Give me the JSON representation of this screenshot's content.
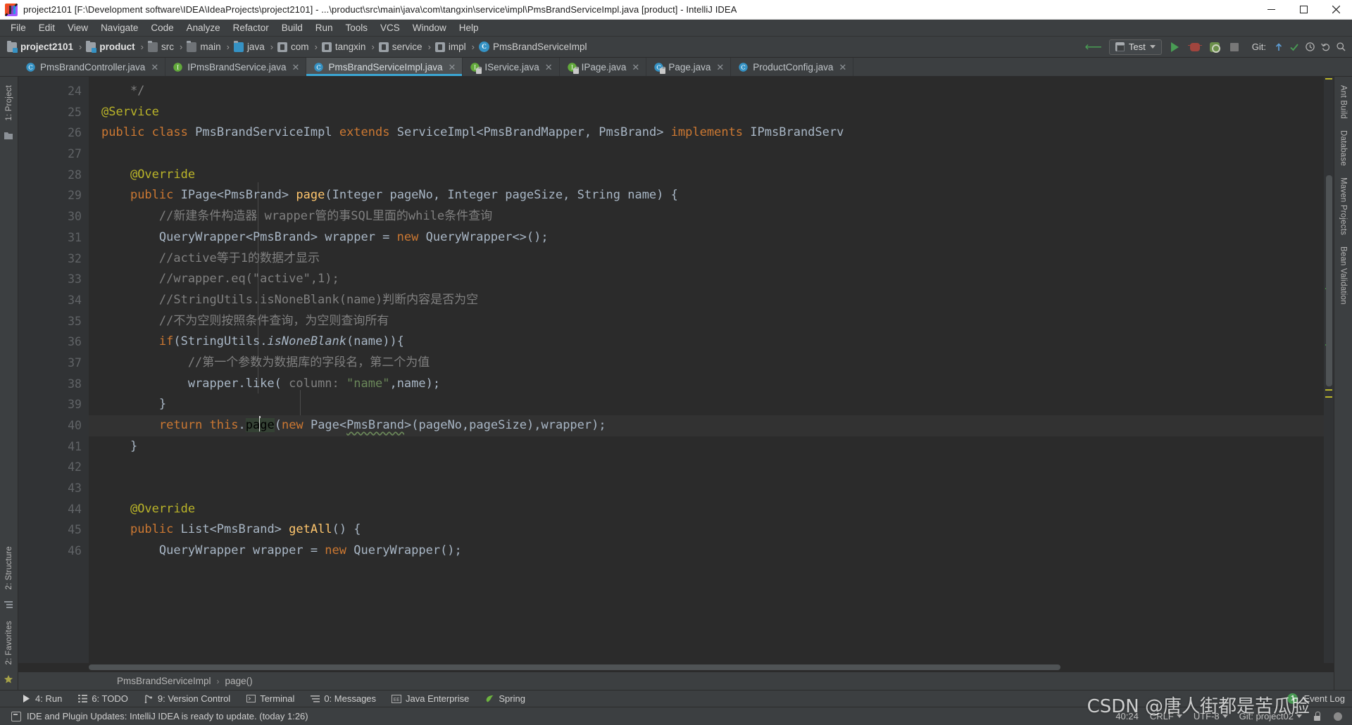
{
  "window": {
    "title": "project2101 [F:\\Development software\\IDEA\\IdeaProjects\\project2101] - ...\\product\\src\\main\\java\\com\\tangxin\\service\\impl\\PmsBrandServiceImpl.java [product] - IntelliJ IDEA",
    "minimize": "minimize-icon",
    "maximize": "maximize-icon",
    "close": "close-icon"
  },
  "menubar": [
    {
      "label": "File"
    },
    {
      "label": "Edit"
    },
    {
      "label": "View"
    },
    {
      "label": "Navigate"
    },
    {
      "label": "Code"
    },
    {
      "label": "Analyze"
    },
    {
      "label": "Refactor"
    },
    {
      "label": "Build"
    },
    {
      "label": "Run"
    },
    {
      "label": "Tools"
    },
    {
      "label": "VCS"
    },
    {
      "label": "Window"
    },
    {
      "label": "Help"
    }
  ],
  "navbar": {
    "crumbs": [
      {
        "label": "project2101",
        "icon": "module-folder-icon",
        "bold": true
      },
      {
        "label": "product",
        "icon": "module-folder-icon",
        "bold": true
      },
      {
        "label": "src",
        "icon": "folder-icon",
        "bold": false
      },
      {
        "label": "main",
        "icon": "folder-icon",
        "bold": false
      },
      {
        "label": "java",
        "icon": "source-root-folder-icon",
        "bold": false
      },
      {
        "label": "com",
        "icon": "package-icon",
        "bold": false
      },
      {
        "label": "tangxin",
        "icon": "package-icon",
        "bold": false
      },
      {
        "label": "service",
        "icon": "package-icon",
        "bold": false
      },
      {
        "label": "impl",
        "icon": "package-icon",
        "bold": false
      },
      {
        "label": "PmsBrandServiceImpl",
        "icon": "class-icon",
        "bold": false
      }
    ],
    "separator": "›",
    "run_config": "Test",
    "git_label": "Git:",
    "run_tooltip": "run-button",
    "debug_tooltip": "debug-button"
  },
  "editor_tabs": [
    {
      "label": "PmsBrandController.java",
      "icon": "java-class-icon",
      "kind": "class",
      "active": false,
      "locked": false
    },
    {
      "label": "IPmsBrandService.java",
      "icon": "java-interface-icon",
      "kind": "interface",
      "active": false,
      "locked": false
    },
    {
      "label": "PmsBrandServiceImpl.java",
      "icon": "java-class-icon",
      "kind": "class",
      "active": true,
      "locked": false
    },
    {
      "label": "IService.java",
      "icon": "java-interface-icon",
      "kind": "interface",
      "active": false,
      "locked": true
    },
    {
      "label": "IPage.java",
      "icon": "java-interface-icon",
      "kind": "interface",
      "active": false,
      "locked": true
    },
    {
      "label": "Page.java",
      "icon": "java-class-icon",
      "kind": "class",
      "active": false,
      "locked": true
    },
    {
      "label": "ProductConfig.java",
      "icon": "java-class-icon",
      "kind": "class",
      "active": false,
      "locked": false
    }
  ],
  "left_rail": [
    {
      "label": "1: Project"
    }
  ],
  "left_rail_bottom": [
    {
      "label": "2: Structure"
    },
    {
      "label": "2: Favorites"
    }
  ],
  "right_rail": [
    {
      "label": "Ant Build"
    },
    {
      "label": "Database"
    },
    {
      "label": "Maven Projects"
    },
    {
      "label": "Bean Validation"
    }
  ],
  "code": {
    "first_line_number": 24,
    "lines": [
      {
        "n": 24,
        "text": "    */",
        "fold": "minus",
        "mark": ""
      },
      {
        "n": 25,
        "text": "@Service",
        "mark": ""
      },
      {
        "n": 26,
        "text": "public class PmsBrandServiceImpl extends ServiceImpl<PmsBrandMapper, PmsBrand> implements IPmsBrandServ",
        "mark": "spring-bean-gutter-icon"
      },
      {
        "n": 27,
        "text": "",
        "mark": ""
      },
      {
        "n": 28,
        "text": "    @Override",
        "mark": ""
      },
      {
        "n": 29,
        "text": "    public IPage<PmsBrand> page(Integer pageNo, Integer pageSize, String name) {",
        "mark": "implementing-method-icon"
      },
      {
        "n": 30,
        "text": "        //新建条件构造器 wrapper管的事SQL里面的while条件查询",
        "mark": ""
      },
      {
        "n": 31,
        "text": "        QueryWrapper<PmsBrand> wrapper = new QueryWrapper<>();",
        "mark": ""
      },
      {
        "n": 32,
        "text": "        //active等于1的数据才显示",
        "mark": ""
      },
      {
        "n": 33,
        "text": "        //wrapper.eq(\"active\",1);",
        "mark": ""
      },
      {
        "n": 34,
        "text": "        //StringUtils.isNoneBlank(name)判断内容是否为空",
        "mark": ""
      },
      {
        "n": 35,
        "text": "        //不为空则按照条件查询，为空则查询所有",
        "mark": ""
      },
      {
        "n": 36,
        "text": "        if(StringUtils.isNoneBlank(name)){",
        "mark": ""
      },
      {
        "n": 37,
        "text": "            //第一个参数为数据库的字段名，第二个为值",
        "mark": ""
      },
      {
        "n": 38,
        "text": "            wrapper.like( column: \"name\",name);",
        "mark": ""
      },
      {
        "n": 39,
        "text": "        }",
        "mark": ""
      },
      {
        "n": 40,
        "text": "        return this.page(new Page<PmsBrand>(pageNo,pageSize),wrapper);",
        "mark": "",
        "highlighted": true
      },
      {
        "n": 41,
        "text": "    }",
        "mark": ""
      },
      {
        "n": 42,
        "text": "",
        "mark": ""
      },
      {
        "n": 43,
        "text": "",
        "mark": ""
      },
      {
        "n": 44,
        "text": "    @Override",
        "mark": ""
      },
      {
        "n": 45,
        "text": "    public List<PmsBrand> getAll() {",
        "mark": "implementing-method-icon"
      },
      {
        "n": 46,
        "text": "        QueryWrapper wrapper = new QueryWrapper();",
        "mark": ""
      }
    ]
  },
  "editor_breadcrumbs": {
    "class": "PmsBrandServiceImpl",
    "separator": "›",
    "method": "page()"
  },
  "bottom_tools": [
    {
      "label": "4: Run",
      "mnemonic": "4",
      "icon": "run-icon"
    },
    {
      "label": "6: TODO",
      "mnemonic": "6",
      "icon": "todo-icon"
    },
    {
      "label": "9: Version Control",
      "mnemonic": "9",
      "icon": "version-control-icon"
    },
    {
      "label": "Terminal",
      "mnemonic": "",
      "icon": "terminal-icon"
    },
    {
      "label": "0: Messages",
      "mnemonic": "0",
      "icon": "messages-icon"
    },
    {
      "label": "Java Enterprise",
      "mnemonic": "",
      "icon": "java-enterprise-icon"
    },
    {
      "label": "Spring",
      "mnemonic": "",
      "icon": "spring-icon"
    }
  ],
  "event_log": {
    "count": "1",
    "label": "Event Log"
  },
  "statusbar": {
    "message": "IDE and Plugin Updates: IntelliJ IDEA is ready to update. (today 1:26)",
    "caret_position": "40:24",
    "line_separator": "CRLF",
    "encoding": "UTF-8",
    "git_branch": "Git: project02"
  },
  "watermark": "CSDN @唐人街都是苦瓜脸",
  "colors": {
    "bg_panel": "#3c3f41",
    "bg_editor": "#2b2b2b",
    "bg_gutter": "#313335",
    "accent_tab": "#3ba7d4",
    "keyword": "#cc7832",
    "annotation": "#bbb529",
    "comment": "#808080",
    "string": "#6a8759",
    "number": "#6897bb",
    "identifier": "#a9b7c6",
    "method": "#ffc66d",
    "run_green": "#499c54"
  }
}
